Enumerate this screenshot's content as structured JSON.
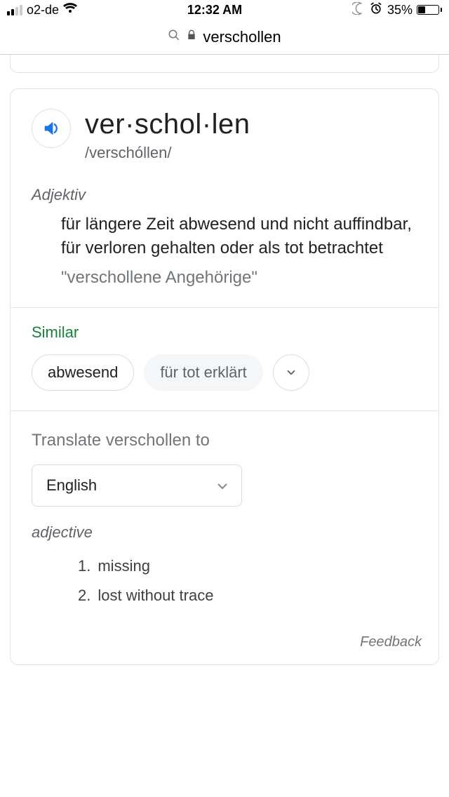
{
  "status": {
    "carrier": "o2-de",
    "time": "12:32 AM",
    "battery_pct": "35%"
  },
  "address": {
    "text": "verschollen"
  },
  "dict": {
    "headword": "ver·schol·len",
    "pronunciation": "/verschóllen/",
    "pos": "Adjektiv",
    "definition": "für längere Zeit abwesend und nicht auffindbar, für verloren gehalten oder als tot betrachtet",
    "example": "\"verschollene Angehörige\"",
    "similar_label": "Similar",
    "similar": [
      "abwesend",
      "für tot erklärt"
    ],
    "translate_label": "Translate verschollen to",
    "translate_target": "English",
    "translate_pos": "adjective",
    "translations": [
      {
        "n": "1.",
        "t": "missing"
      },
      {
        "n": "2.",
        "t": "lost without trace"
      }
    ],
    "feedback": "Feedback"
  }
}
